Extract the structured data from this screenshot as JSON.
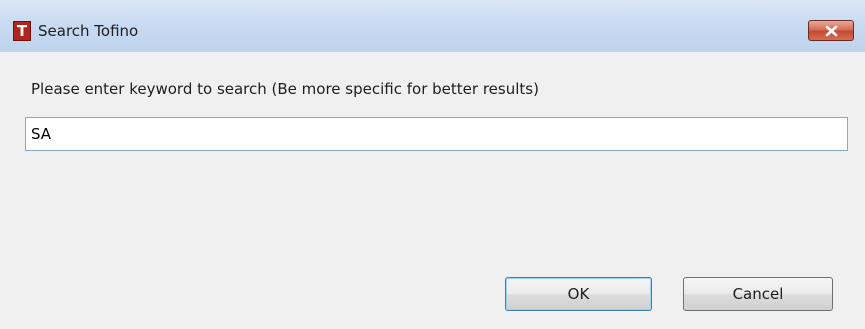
{
  "window": {
    "title": "Search Tofino",
    "icon_letter": "T",
    "icon_name": "tofino-app-icon",
    "close_icon": "close-icon"
  },
  "dialog": {
    "prompt": "Please enter keyword to search (Be more specific for better results)",
    "search_value": "SA",
    "ok_label": "OK",
    "cancel_label": "Cancel"
  },
  "colors": {
    "titlebar": "#c9dbf1",
    "close_button": "#c24a33",
    "app_icon": "#b4231f",
    "default_button_border": "#3c7fb1",
    "dialog_background": "#f0f0f0"
  }
}
